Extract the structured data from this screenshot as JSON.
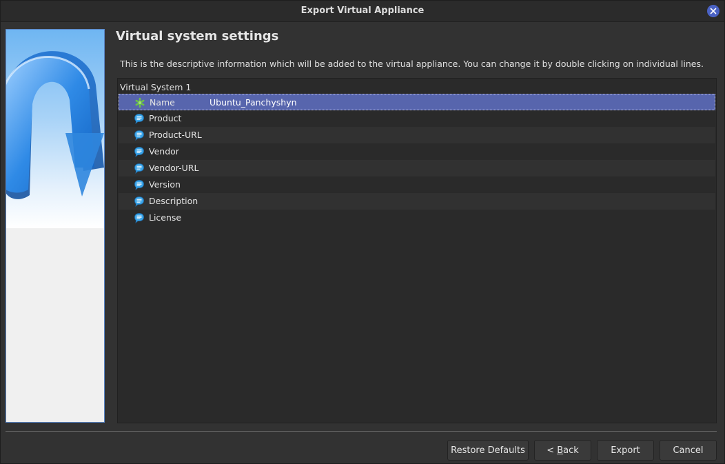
{
  "window": {
    "title": "Export Virtual Appliance",
    "close_icon": "close-icon"
  },
  "page": {
    "heading": "Virtual system settings",
    "description": "This is the descriptive information which will be added to the virtual appliance. You can change it by double clicking on individual lines."
  },
  "tree": {
    "root_label": "Virtual System 1",
    "rows": [
      {
        "label": "Name",
        "value": "Ubuntu_Panchyshyn",
        "icon": "name-asterisk-icon",
        "selected": true
      },
      {
        "label": "Product",
        "value": "",
        "icon": "description-bubble-icon"
      },
      {
        "label": "Product-URL",
        "value": "",
        "icon": "description-bubble-icon"
      },
      {
        "label": "Vendor",
        "value": "",
        "icon": "description-bubble-icon"
      },
      {
        "label": "Vendor-URL",
        "value": "",
        "icon": "description-bubble-icon"
      },
      {
        "label": "Version",
        "value": "",
        "icon": "description-bubble-icon"
      },
      {
        "label": "Description",
        "value": "",
        "icon": "description-bubble-icon"
      },
      {
        "label": "License",
        "value": "",
        "icon": "description-bubble-icon"
      }
    ]
  },
  "buttons": {
    "restore_defaults": "Restore Defaults",
    "back_prefix": "< ",
    "back_mnemonic": "B",
    "back_rest": "ack",
    "export": "Export",
    "cancel": "Cancel"
  },
  "colors": {
    "selection": "#5765ad",
    "accent_close": "#4a62c4",
    "bubble_icon": "#3aa4e8",
    "asterisk_icon": "#6cc04a"
  }
}
